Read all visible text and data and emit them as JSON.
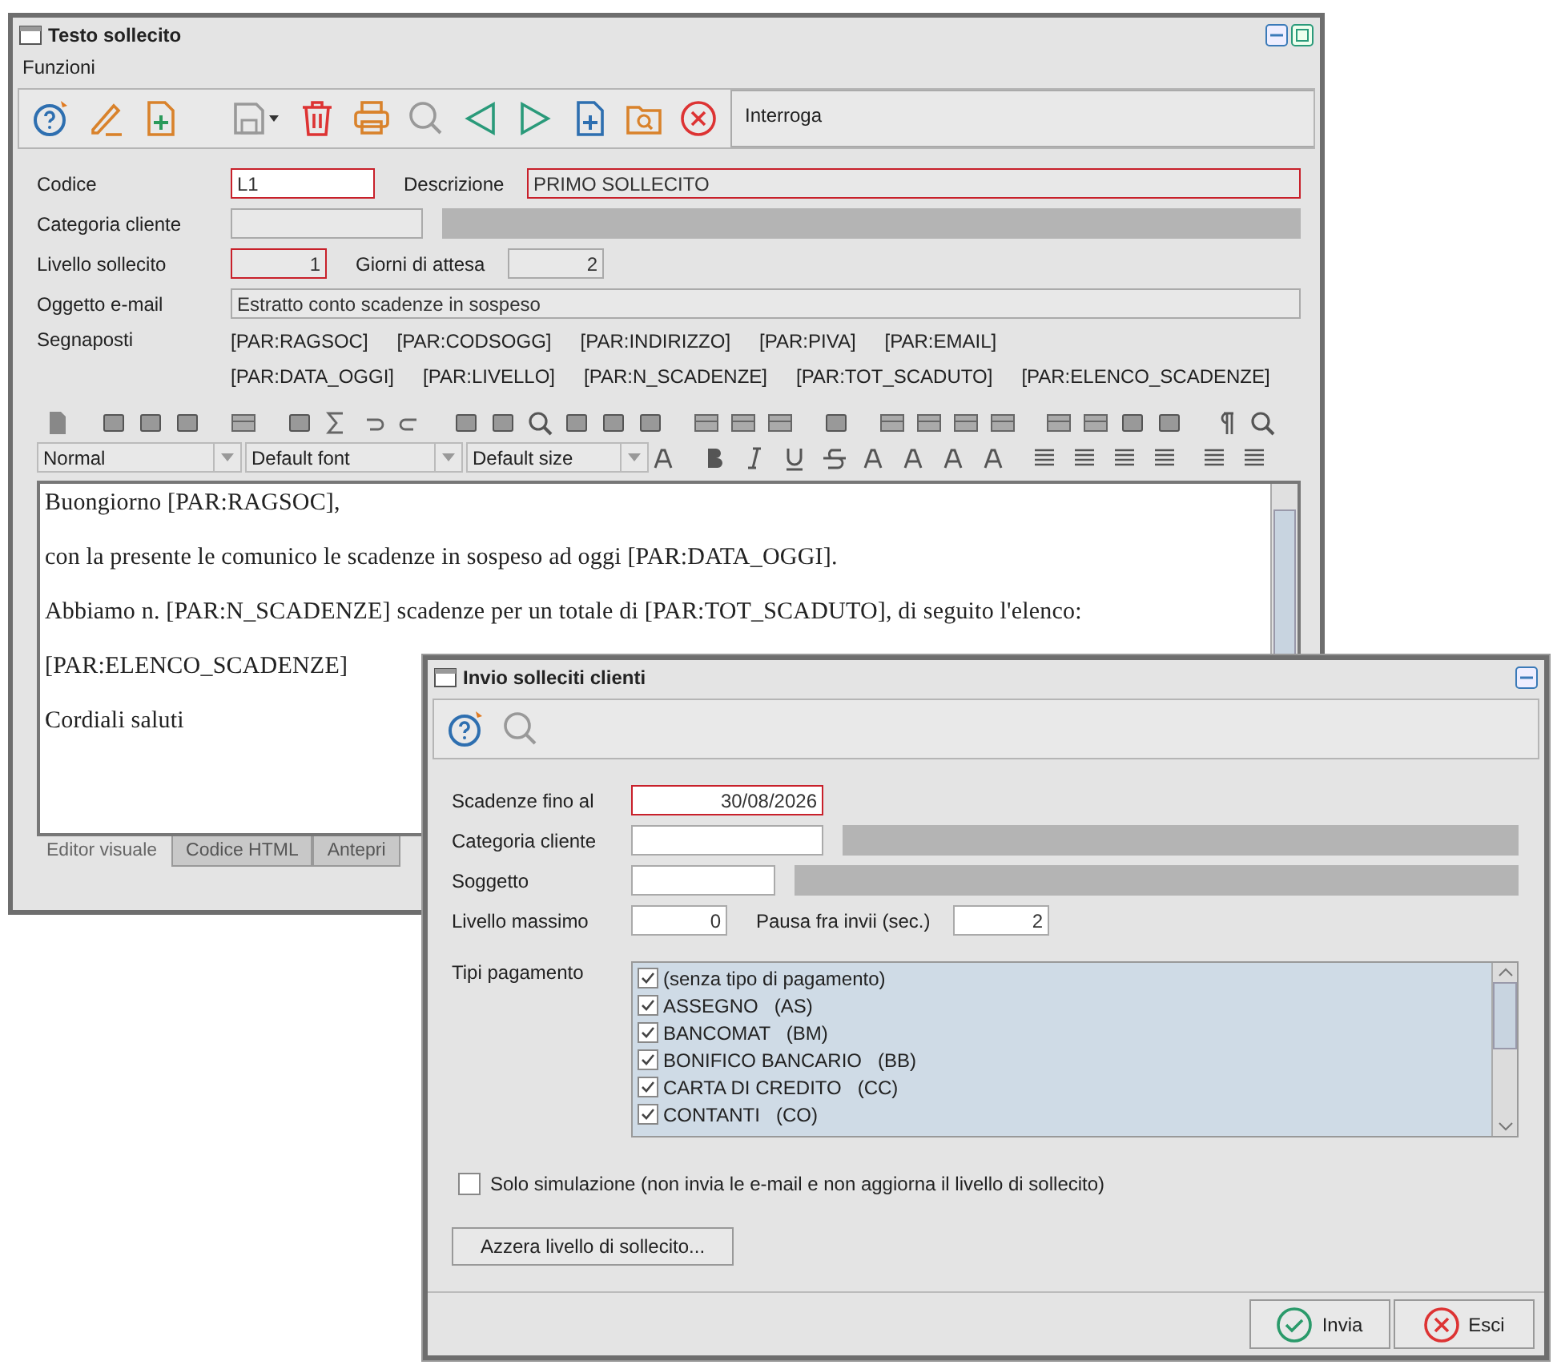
{
  "main_window": {
    "title": "Testo sollecito",
    "menu": [
      "Funzioni"
    ],
    "toolbar_status": "Interroga",
    "form": {
      "codice": {
        "label": "Codice",
        "value": "L1",
        "required": true
      },
      "descrizione": {
        "label": "Descrizione",
        "value": "PRIMO SOLLECITO",
        "required": true
      },
      "categoria": {
        "label": "Categoria cliente"
      },
      "livello": {
        "label": "Livello sollecito",
        "value": "1",
        "required": true
      },
      "giorni": {
        "label": "Giorni di attesa",
        "value": "2",
        "required": false
      },
      "oggetto": {
        "label": "Oggetto e-mail",
        "value": "Estratto conto scadenze in sospeso",
        "required": false
      },
      "segnaposti": {
        "label": "Segnaposti",
        "items": [
          "[PAR:RAGSOC]",
          "[PAR:CODSOGG]",
          "[PAR:INDIRIZZO]",
          "[PAR:PIVA]",
          "[PAR:EMAIL]",
          "[PAR:DATA_OGGI]",
          "[PAR:LIVELLO]",
          "[PAR:N_SCADENZE]",
          "[PAR:TOT_SCADUTO]",
          "[PAR:ELENCO_SCADENZE]"
        ]
      }
    },
    "editor": {
      "style": "Normal",
      "font": "Default font",
      "size": "Default size",
      "paragraphs": [
        "Buongiorno [PAR:RAGSOC],",
        "con la presente le comunico le scadenze in sospeso ad oggi [PAR:DATA_OGGI].",
        "Abbiamo n. [PAR:N_SCADENZE] scadenze per un totale di [PAR:TOT_SCADUTO], di seguito l'elenco:",
        "[PAR:ELENCO_SCADENZE]",
        "Cordiali saluti"
      ],
      "tabs": [
        {
          "label": "Editor visuale",
          "selected": true
        },
        {
          "label": "Codice HTML",
          "selected": false
        },
        {
          "label": "Antepri",
          "selected": false
        }
      ]
    }
  },
  "dialog": {
    "title": "Invio solleciti clienti",
    "scadenze": {
      "label": "Scadenze fino al",
      "value": "30/08/2026",
      "required": true
    },
    "categoria": {
      "label": "Categoria cliente"
    },
    "soggetto": {
      "label": "Soggetto"
    },
    "livello_massimo": {
      "label": "Livello massimo",
      "value": "0"
    },
    "pausa": {
      "label": "Pausa fra invii (sec.)",
      "value": "2"
    },
    "payment_types": {
      "label": "Tipi pagamento",
      "items": [
        {
          "label": "(senza tipo di pagamento)",
          "checked": true
        },
        {
          "label": "ASSEGNO   (AS)",
          "checked": true
        },
        {
          "label": "BANCOMAT   (BM)",
          "checked": true
        },
        {
          "label": "BONIFICO BANCARIO   (BB)",
          "checked": true
        },
        {
          "label": "CARTA DI CREDITO   (CC)",
          "checked": true
        },
        {
          "label": "CONTANTI   (CO)",
          "checked": true
        }
      ]
    },
    "simulation": {
      "label": "Solo simulazione (non invia le e-mail e non aggiorna il livello di sollecito)",
      "checked": false
    },
    "reset_button": "Azzera livello di sollecito...",
    "buttons": [
      {
        "label": "Invia",
        "kind": "ok"
      },
      {
        "label": "Esci",
        "kind": "cancel"
      }
    ]
  }
}
